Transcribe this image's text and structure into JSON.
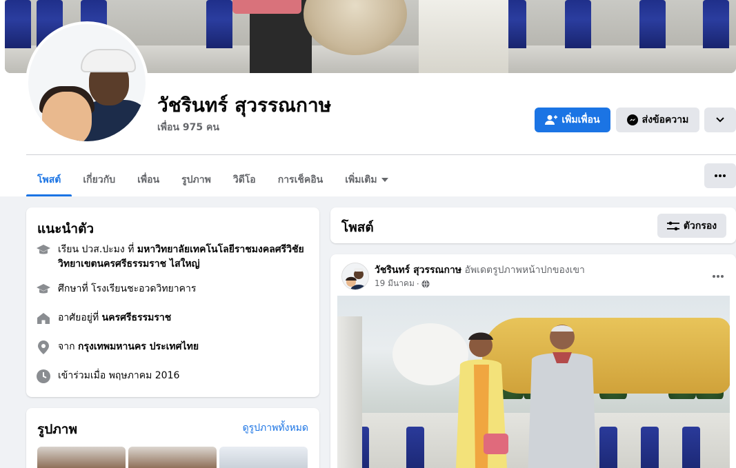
{
  "profile": {
    "name": "วัชรินทร์ สุวรรณกาษ",
    "friends": "เพื่อน 975 คน"
  },
  "actions": {
    "add_friend": "เพิ่มเพื่อน",
    "message": "ส่งข้อความ"
  },
  "tabs": [
    {
      "label": "โพสต์",
      "active": true
    },
    {
      "label": "เกี่ยวกับ",
      "active": false
    },
    {
      "label": "เพื่อน",
      "active": false
    },
    {
      "label": "รูปภาพ",
      "active": false
    },
    {
      "label": "วิดีโอ",
      "active": false
    },
    {
      "label": "การเช็คอิน",
      "active": false
    },
    {
      "label": "เพิ่มเติม",
      "active": false
    }
  ],
  "intro": {
    "title": "แนะนำตัว",
    "education1_prefix": "เรียน ปวส.ปะมง ที่ ",
    "education1_place": "มหาวิทยาลัยเทคโนโลยีราชมงคลศรีวิชัย วิทยาเขตนครศรีธรรมราช ไสใหญ่",
    "education2": "ศึกษาที่ โรงเรียนชะอวดวิทยาคาร",
    "lives_prefix": "อาศัยอยู่ที่ ",
    "lives_place": "นครศรีธรรมราช",
    "from_prefix": "จาก ",
    "from_place": "กรุงเทพมหานคร ประเทศไทย",
    "joined": "เข้าร่วมเมื่อ พฤษภาคม 2016"
  },
  "photos": {
    "title": "รูปภาพ",
    "see_all": "ดูรูปภาพทั้งหมด"
  },
  "posts": {
    "title": "โพสต์",
    "filter": "ตัวกรอง"
  },
  "post": {
    "author": "วัชรินทร์ สุวรรณกาษ",
    "action": "อัพเดตรูปภาพหน้าปกของเขา",
    "date": "19 มีนาคม",
    "dot": "·"
  },
  "colors": {
    "accent": "#1b74e4",
    "muted_text": "#65676b",
    "button_gray": "#e4e6eb",
    "page_bg": "#f0f2f5"
  },
  "icons": [
    "add-friend-icon",
    "messenger-icon",
    "chevron-down-icon",
    "more-dots-icon",
    "graduation-cap-icon",
    "home-icon",
    "location-pin-icon",
    "clock-icon",
    "filter-icon",
    "globe-icon"
  ]
}
